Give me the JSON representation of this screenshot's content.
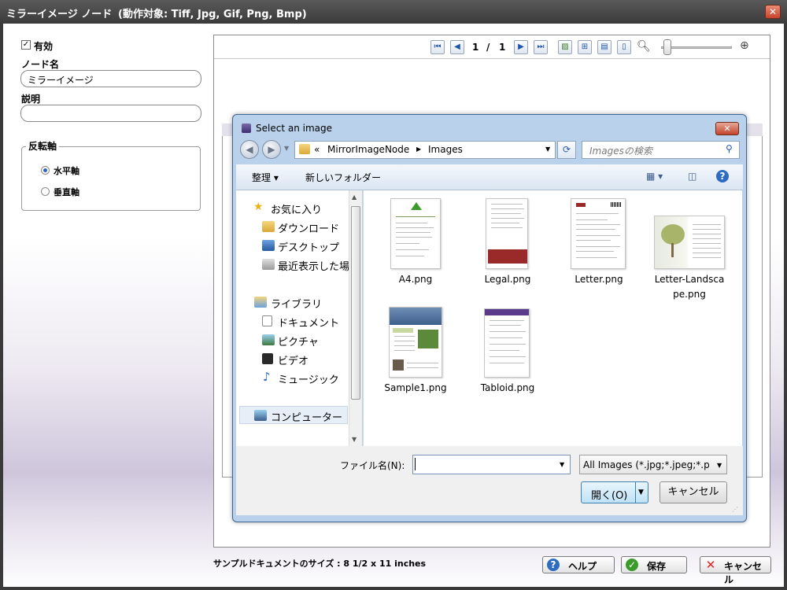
{
  "window": {
    "title": "ミラーイメージ ノード",
    "subtitle": "(動作対象: Tiff, Jpg, Gif, Png, Bmp)",
    "close_glyph": "✕"
  },
  "left": {
    "enabled_label": "有効",
    "enabled_checked": true,
    "node_name_label": "ノード名",
    "node_name_value": "ミラーイメージ",
    "description_label": "説明",
    "description_value": "",
    "flip_axis_label": "反転軸",
    "horizontal_label": "水平軸",
    "vertical_label": "垂直軸",
    "selected_axis": "horizontal"
  },
  "preview_toolbar": {
    "page_current": "1",
    "page_sep": "/",
    "page_total": "1"
  },
  "footer": {
    "sample_size": "サンプルドキュメントのサイズ : 8 1/2 x 11 inches",
    "help_label": "ヘルプ",
    "save_label": "保存",
    "cancel_label": "キャンセル"
  },
  "dialog": {
    "title": "Select an image",
    "breadcrumb_prefix": "«",
    "breadcrumb": [
      "MirrorImageNode",
      "Images"
    ],
    "search_placeholder": "Imagesの検索",
    "organize_label": "整理 ▾",
    "new_folder_label": "新しいフォルダー",
    "nav": {
      "favorites": "お気に入り",
      "downloads": "ダウンロード",
      "desktop": "デスクトップ",
      "recent": "最近表示した場所",
      "libraries": "ライブラリ",
      "documents": "ドキュメント",
      "pictures": "ピクチャ",
      "videos": "ビデオ",
      "music": "ミュージック",
      "computer": "コンピューター"
    },
    "files": [
      {
        "name": "A4.png"
      },
      {
        "name": "Legal.png"
      },
      {
        "name": "Letter.png"
      },
      {
        "name": "Letter-Landscape.png",
        "line1": "Letter-Landsca",
        "line2": "pe.png"
      },
      {
        "name": "Sample1.png"
      },
      {
        "name": "Tabloid.png"
      }
    ],
    "filename_label": "ファイル名(N):",
    "filename_value": "",
    "filter_label": "All Images (*.jpg;*.jpeg;*.p",
    "open_label": "開く(O)",
    "cancel_label": "キャンセル"
  },
  "colors": {
    "accent": "#2a63c4",
    "title_bar": "#3a3a3a",
    "dialog_frame": "#b9d1ea",
    "close_red": "#c3452c"
  }
}
